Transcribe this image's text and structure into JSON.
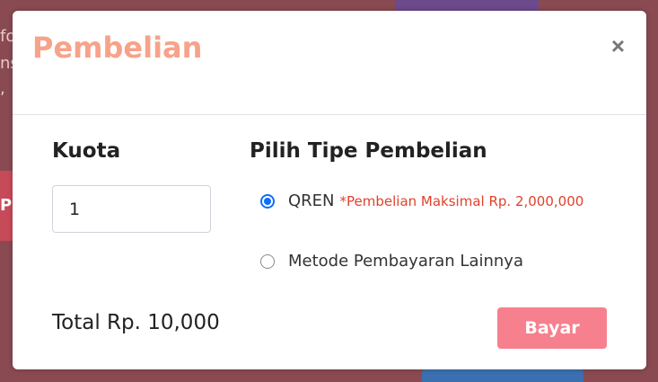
{
  "background": {
    "fragments": [
      "fo",
      "ns",
      ","
    ],
    "button_letter": "P"
  },
  "modal": {
    "title": "Pembelian",
    "close_symbol": "×",
    "kuota": {
      "label": "Kuota",
      "value": "1"
    },
    "purchase_type": {
      "label": "Pilih Tipe Pembelian",
      "options": [
        {
          "label": "QREN",
          "note": "*Pembelian Maksimal Rp. 2,000,000",
          "selected": true
        },
        {
          "label": "Metode Pembayaran Lainnya",
          "selected": false
        }
      ]
    },
    "total": "Total Rp. 10,000",
    "pay_button": "Bayar"
  },
  "colors": {
    "title": "#f7a28a",
    "pay_button": "#f7808e",
    "note": "#e0412c",
    "radio_selected": "#0d6efd"
  }
}
